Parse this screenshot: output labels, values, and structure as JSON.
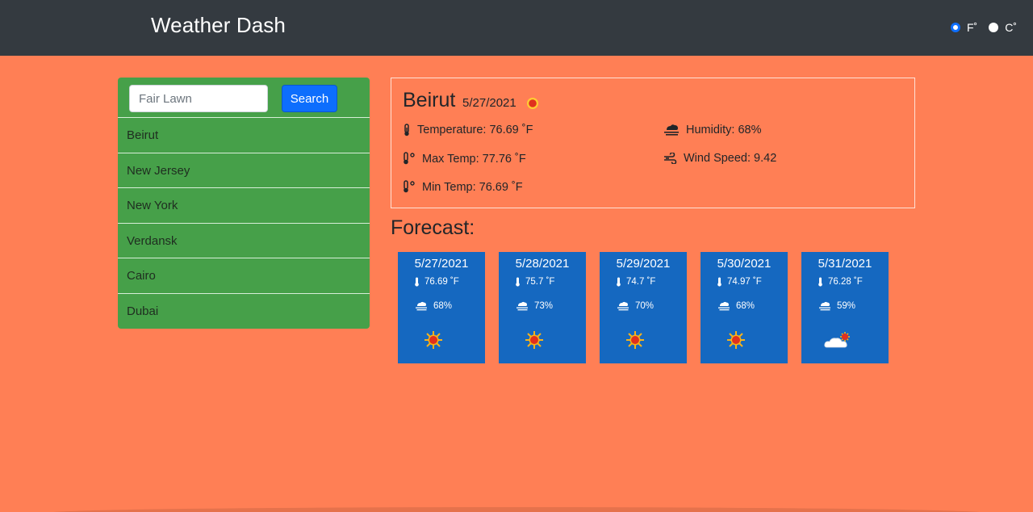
{
  "navbar": {
    "brand": "Weather Dash",
    "units": [
      {
        "label": "F˚",
        "checked": true
      },
      {
        "label": "C˚",
        "checked": false
      }
    ]
  },
  "search": {
    "placeholder": "Fair Lawn",
    "button_label": "Search"
  },
  "history": [
    "Beirut",
    "New Jersey",
    "New York",
    "Verdansk",
    "Cairo",
    "Dubai"
  ],
  "current": {
    "city": "Beirut",
    "date": "5/27/2021",
    "icon": "sun-icon",
    "temperature": "Temperature: 76.69 ˚F",
    "max_temp": "Max Temp: 77.76 ˚F",
    "min_temp": "Min Temp: 76.69 ˚F",
    "humidity": "Humidity: 68%",
    "wind": "Wind Speed: 9.42"
  },
  "forecast": {
    "title": "Forecast:",
    "days": [
      {
        "date": "5/27/2021",
        "temp": "76.69 ˚F",
        "humidity": "68%",
        "icon": "sun-icon"
      },
      {
        "date": "5/28/2021",
        "temp": "75.7 ˚F",
        "humidity": "73%",
        "icon": "sun-icon"
      },
      {
        "date": "5/29/2021",
        "temp": "74.7 ˚F",
        "humidity": "70%",
        "icon": "sun-icon"
      },
      {
        "date": "5/30/2021",
        "temp": "74.97 ˚F",
        "humidity": "68%",
        "icon": "sun-icon"
      },
      {
        "date": "5/31/2021",
        "temp": "76.28 ˚F",
        "humidity": "59%",
        "icon": "sun-behind-cloud-icon"
      }
    ]
  },
  "colors": {
    "background": "#ff7f55",
    "navbar": "#343a40",
    "sidebar": "#46a049",
    "card": "#1568c0",
    "button": "#0d6efd"
  }
}
